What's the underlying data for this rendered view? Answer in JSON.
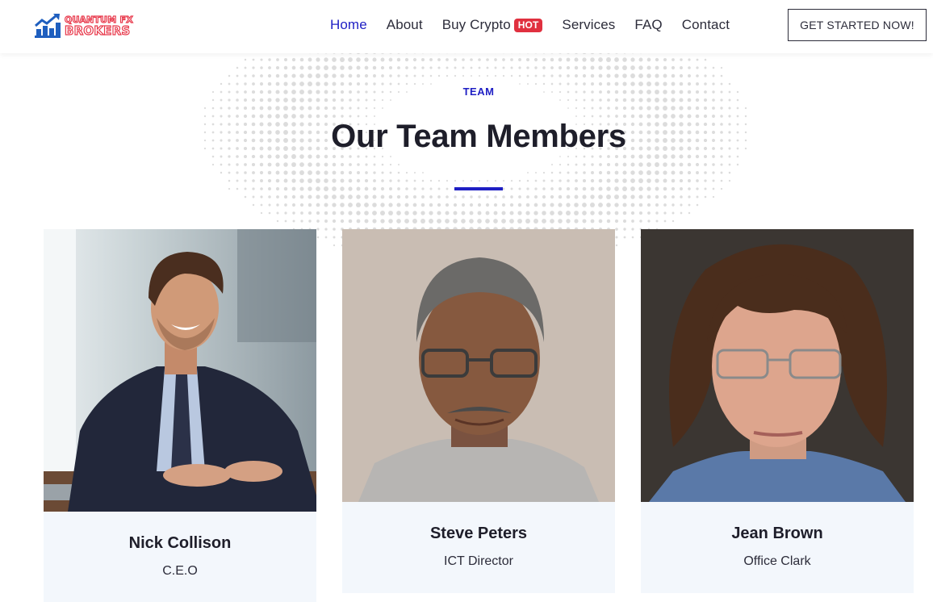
{
  "brand": {
    "line1": "QUANTUM FX",
    "line2": "BROKERS",
    "accent": "#e83a4c"
  },
  "nav": {
    "home": "Home",
    "about": "About",
    "buy_crypto": "Buy Crypto",
    "hot_badge": "HOT",
    "services": "Services",
    "faq": "FAQ",
    "contact": "Contact",
    "active_color": "#1f1fc4"
  },
  "cta": {
    "label": "GET STARTED NOW!"
  },
  "section": {
    "eyebrow": "TEAM",
    "title": "Our Team Members"
  },
  "team": [
    {
      "name": "Nick Collison",
      "role": "C.E.O"
    },
    {
      "name": "Steve Peters",
      "role": "ICT Director"
    },
    {
      "name": "Jean Brown",
      "role": "Office Clark"
    }
  ]
}
